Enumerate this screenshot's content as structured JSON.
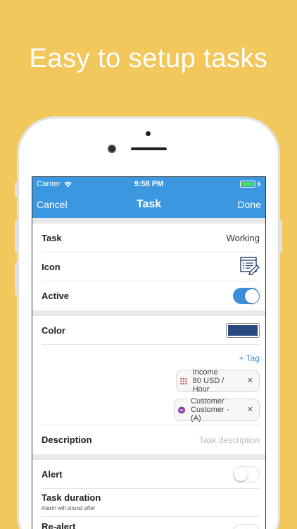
{
  "headline": "Easy to setup tasks",
  "status_bar": {
    "carrier": "Carrier",
    "time": "9:58 PM",
    "battery_level": 1.0
  },
  "nav": {
    "cancel": "Cancel",
    "title": "Task",
    "done": "Done"
  },
  "rows": {
    "task": {
      "label": "Task",
      "value": "Working"
    },
    "icon": {
      "label": "Icon",
      "icon_name": "task-list-icon"
    },
    "active": {
      "label": "Active",
      "on": true
    },
    "color": {
      "label": "Color",
      "value_hex": "#27497F"
    },
    "add_tag": "+ Tag",
    "tags": [
      {
        "line1": "Income",
        "line2": "80 USD / Hour",
        "icon_name": "grid-dots-icon",
        "color": "#D8344C"
      },
      {
        "line1": "Customer",
        "line2": "Customer - (A)",
        "icon_name": "chevron-circle-icon",
        "color": "#8A3FA6"
      }
    ],
    "description": {
      "label": "Description",
      "placeholder": "Task description"
    },
    "alert": {
      "label": "Alert",
      "on": false
    },
    "task_duration": {
      "label": "Task duration",
      "sub": "Alarm will sound after"
    },
    "re_alert": {
      "label": "Re-alert"
    }
  },
  "colors": {
    "background": "#F2C75C",
    "nav_blue": "#3B97E0",
    "toggle_blue": "#3B8FDA",
    "battery_green": "#4CD964"
  }
}
